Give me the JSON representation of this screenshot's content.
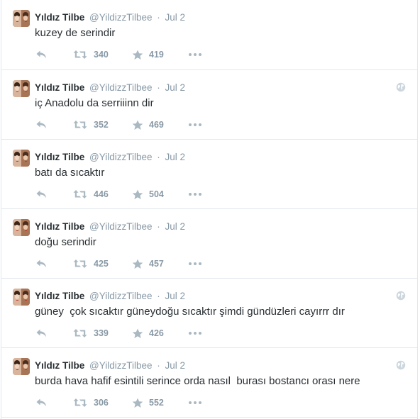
{
  "tweets": [
    {
      "name": "Yıldız Tilbe",
      "handle": "@YildizzTilbee",
      "time": "Jul 2",
      "text": "kuzey de serindir",
      "retweets": "340",
      "favorites": "419",
      "geo": false
    },
    {
      "name": "Yıldız Tilbe",
      "handle": "@YildizzTilbee",
      "time": "Jul 2",
      "text": "iç Anadolu da serriiinn dir",
      "retweets": "352",
      "favorites": "469",
      "geo": true
    },
    {
      "name": "Yıldız Tilbe",
      "handle": "@YildizzTilbee",
      "time": "Jul 2",
      "text": "batı da sıcaktır",
      "retweets": "446",
      "favorites": "504",
      "geo": false
    },
    {
      "name": "Yıldız Tilbe",
      "handle": "@YildizzTilbee",
      "time": "Jul 2",
      "text": "doğu serindir",
      "retweets": "425",
      "favorites": "457",
      "geo": false
    },
    {
      "name": "Yıldız Tilbe",
      "handle": "@YildizzTilbee",
      "time": "Jul 2",
      "text": "güney  çok sıcaktır güneydoğu sıcaktır şimdi gündüzleri cayırrr dır",
      "retweets": "339",
      "favorites": "426",
      "geo": true
    },
    {
      "name": "Yıldız Tilbe",
      "handle": "@YildizzTilbee",
      "time": "Jul 2",
      "text": "burda hava hafif esintili serince orda nasıl  burası bostancı orası nere",
      "retweets": "306",
      "favorites": "552",
      "geo": true
    }
  ],
  "icons": {
    "reply": "reply-icon",
    "retweet": "retweet-icon",
    "favorite": "star-icon",
    "more": "more-dots-icon",
    "geo": "globe-icon"
  },
  "colors": {
    "text": "#292f33",
    "muted": "#8899a6",
    "icon": "#aab8c2",
    "border": "#e1e8ed"
  }
}
